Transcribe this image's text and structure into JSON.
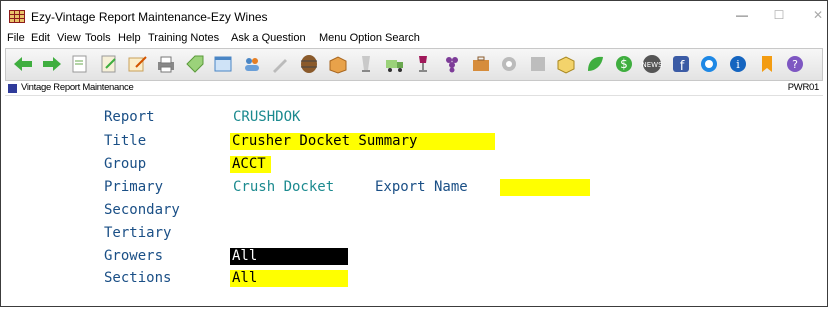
{
  "window": {
    "title": "Ezy-Vintage Report Maintenance-Ezy Wines"
  },
  "menu": [
    "File",
    "Edit",
    "View",
    "Tools",
    "Help",
    "Training Notes",
    "Ask a Question",
    "Menu Option Search"
  ],
  "toolbar_icons": [
    "back-arrow-icon",
    "forward-arrow-icon",
    "new-document-icon",
    "edit-document-icon",
    "write-document-icon",
    "printer-icon",
    "tag-icon",
    "window-icon",
    "users-icon",
    "pencil-icon",
    "barrel-icon",
    "box-icon",
    "glass-icon",
    "truck-icon",
    "wine-glass-icon",
    "grapes-icon",
    "briefcase-icon",
    "gear-icon",
    "grey-square-icon",
    "cube-icon",
    "leaf-icon",
    "dollar-icon",
    "news-icon",
    "facebook-icon",
    "blue-circle-icon",
    "info-icon",
    "bookmark-icon",
    "help-icon"
  ],
  "strip": {
    "label": "Vintage Report Maintenance",
    "code": "PWR01"
  },
  "form": {
    "report": {
      "label": "Report",
      "value": "CRUSHDOK"
    },
    "title": {
      "label": "Title",
      "value": "Crusher Docket Summary"
    },
    "group": {
      "label": "Group",
      "value": "ACCT"
    },
    "primary": {
      "label": "Primary",
      "value": "Crush Docket"
    },
    "export": {
      "label": "Export Name",
      "value": ""
    },
    "secondary": {
      "label": "Secondary"
    },
    "tertiary": {
      "label": "Tertiary"
    },
    "growers": {
      "label": "Growers",
      "value": "All"
    },
    "sections": {
      "label": "Sections",
      "value": "All"
    }
  },
  "colors": {
    "label": "#1a4f86",
    "teal": "#1b8a8f",
    "highlight": "#ffff00",
    "selected": "#000000"
  }
}
